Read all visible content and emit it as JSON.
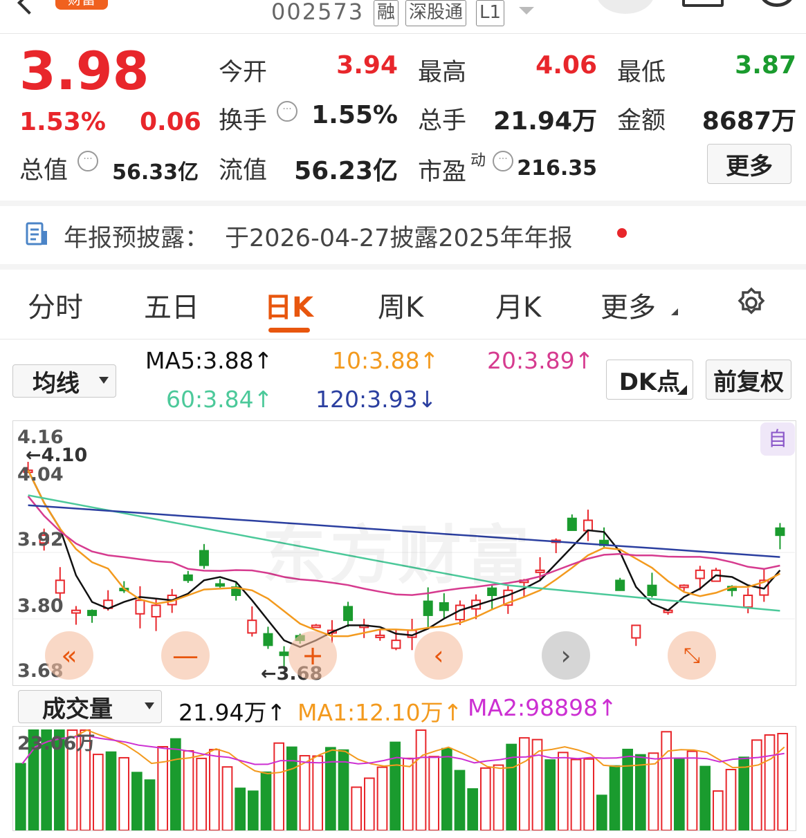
{
  "header": {
    "stock_code": "002573",
    "badges": [
      "融",
      "深股通",
      "L1"
    ],
    "tag": "财富"
  },
  "quote": {
    "price": "3.98",
    "change_pct": "1.53%",
    "change_abs": "0.06",
    "fields": {
      "open_label": "今开",
      "open": "3.94",
      "high_label": "最高",
      "high": "4.06",
      "low_label": "最低",
      "low": "3.87",
      "turnover_label": "换手",
      "turnover": "1.55%",
      "volume_label": "总手",
      "volume": "21.94万",
      "amount_label": "金额",
      "amount": "8687万",
      "mktcap_label": "总值",
      "mktcap": "56.33亿",
      "float_label": "流值",
      "float": "56.23亿",
      "pe_label": "市盈",
      "pe_sup": "动",
      "pe": "216.35"
    },
    "more_button": "更多"
  },
  "notice": {
    "label": "年报预披露：",
    "text": "于2026-04-27披露2025年年报"
  },
  "tabs": [
    {
      "label": "分时",
      "active": false
    },
    {
      "label": "五日",
      "active": false
    },
    {
      "label": "日K",
      "active": true
    },
    {
      "label": "周K",
      "active": false
    },
    {
      "label": "月K",
      "active": false
    },
    {
      "label": "更多",
      "active": false
    }
  ],
  "indicator": {
    "select": "均线",
    "ma5": "MA5:3.88↑",
    "ma10": "10:3.88↑",
    "ma20": "20:3.89↑",
    "ma60": "60:3.84↑",
    "ma120": "120:3.93↓",
    "dk_button": "DK点",
    "adjust_button": "前复权"
  },
  "kline": {
    "y_labels": [
      "4.16",
      "4.04",
      "3.92",
      "3.80",
      "3.68"
    ],
    "max_marker": "←4.10",
    "min_marker": "←3.68",
    "self_button": "自",
    "watermark": "东方财富"
  },
  "volume": {
    "select": "成交量",
    "current": "21.94万↑",
    "ma1": "MA1:12.10万↑",
    "ma2": "MA2:98898↑",
    "max_label": "23.06万"
  },
  "colors": {
    "up": "#e8262b",
    "down": "#1a9b2e",
    "accent": "#e8560e",
    "ma5": "#111111",
    "ma10": "#f39a1e",
    "ma20": "#d63b8f",
    "ma60": "#4cc99a",
    "ma120": "#2b3fa0"
  },
  "icons": {
    "notice": "document-icon",
    "settings": "gear-icon",
    "nav": [
      "double-left-icon",
      "minus-icon",
      "plus-icon",
      "left-icon",
      "right-icon",
      "expand-icon"
    ]
  }
}
